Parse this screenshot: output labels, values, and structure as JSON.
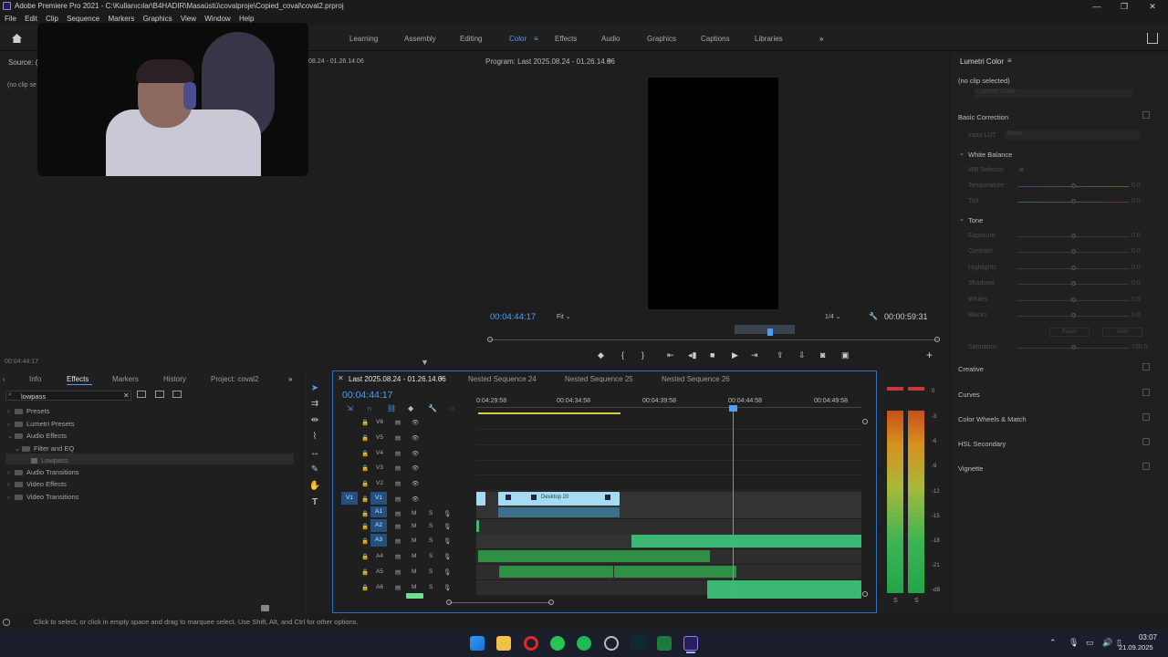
{
  "titlebar": {
    "title": "Adobe Premiere Pro 2021 - C:\\Kullanıcılar\\B4HADIR\\Masaüstü\\covalproje\\Copied_coval\\coval2.prproj",
    "min": "—",
    "max": "❐",
    "close": "✕"
  },
  "menu": [
    "File",
    "Edit",
    "Clip",
    "Sequence",
    "Markers",
    "Graphics",
    "View",
    "Window",
    "Help"
  ],
  "workspaces": [
    "Learning",
    "Assembly",
    "Editing",
    "Color",
    "Effects",
    "Audio",
    "Graphics",
    "Captions",
    "Libraries"
  ],
  "workspace_active": "Color",
  "source": {
    "title": "Source: (n",
    "noclip": "(no clip se",
    "timecode": "00:04:44:17",
    "seq_time": "08.24 - 01.26.14.06"
  },
  "program": {
    "title": "Program: Last 2025.08.24 - 01.26.14.06",
    "timecode": "00:04:44:17",
    "fit": "Fit",
    "resolution": "1/4",
    "duration": "00:00:59:31"
  },
  "lumetri": {
    "title": "Lumetri Color",
    "noclip": "(no clip selected)",
    "fx_label": "Lumetri Color",
    "basic": "Basic Correction",
    "input_lut": "Input LUT",
    "lut_value": "None",
    "white_balance": "White Balance",
    "wb_selector": "WB Selector",
    "wb": [
      {
        "label": "Temperature",
        "value": "0.0"
      },
      {
        "label": "Tint",
        "value": "0.0"
      }
    ],
    "tone": "Tone",
    "tone_sliders": [
      {
        "label": "Exposure",
        "value": "0.0"
      },
      {
        "label": "Contrast",
        "value": "0.0"
      },
      {
        "label": "Highlights",
        "value": "0.0"
      },
      {
        "label": "Shadows",
        "value": "0.0"
      },
      {
        "label": "Whites",
        "value": "0.0"
      },
      {
        "label": "Blacks",
        "value": "0.0"
      }
    ],
    "reset": "Reset",
    "auto": "Auto",
    "saturation": {
      "label": "Saturation",
      "value": "100.0"
    },
    "sections": [
      "Creative",
      "Curves",
      "Color Wheels & Match",
      "HSL Secondary",
      "Vignette"
    ]
  },
  "effects_panel": {
    "tabs": [
      "Info",
      "Effects",
      "Markers",
      "History",
      "Project: coval2"
    ],
    "active_tab": "Effects",
    "search": "lowpass",
    "tree": [
      {
        "label": "Presets",
        "level": 0
      },
      {
        "label": "Lumetri Presets",
        "level": 0
      },
      {
        "label": "Audio Effects",
        "level": 0
      },
      {
        "label": "Filter and EQ",
        "level": 1
      },
      {
        "label": "Lowpass",
        "level": 2
      },
      {
        "label": "Audio Transitions",
        "level": 0
      },
      {
        "label": "Video Effects",
        "level": 0
      },
      {
        "label": "Video Transitions",
        "level": 0
      }
    ]
  },
  "timeline": {
    "tabs": [
      "Last 2025.08.24 - 01.26.14.06",
      "Nested Sequence 24",
      "Nested Sequence 25",
      "Nested Sequence 26"
    ],
    "timecode": "00:04:44:17",
    "ruler": [
      "0:04:29:58",
      "00:04:34:58",
      "00:04:39:58",
      "00:04:44:58",
      "00:04:49:58"
    ],
    "video_tracks": [
      "V6",
      "V5",
      "V4",
      "V3",
      "V2",
      "V1"
    ],
    "audio_tracks": [
      "A1",
      "A2",
      "A3",
      "A4",
      "A5",
      "A6"
    ],
    "src_patch_v": "V1",
    "clip_label": "Desktop 20",
    "mute": "M",
    "solo": "S"
  },
  "meter_scale": [
    "0",
    "-3",
    "-6",
    "-9",
    "-12",
    "-15",
    "-18",
    "-21",
    "-dB"
  ],
  "meter_solo": [
    "S",
    "S"
  ],
  "status_text": "Click to select, or click in empty space and drag to marquee select. Use Shift, Alt, and Ctrl for other options.",
  "clock": {
    "time": "03:07",
    "date": "21.09.2025"
  },
  "colors": {
    "accent": "#4d9dfc",
    "audio_clip": "#3bb873",
    "video_clip": "#a6dcf2"
  }
}
